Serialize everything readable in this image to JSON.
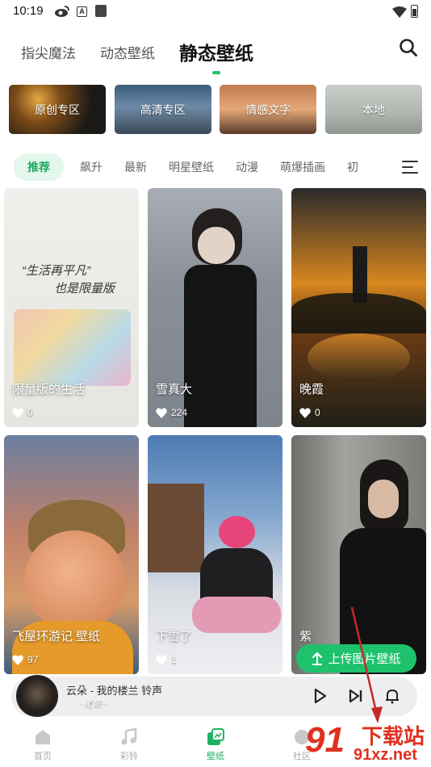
{
  "status_bar": {
    "time": "10:19",
    "a_icon": "A"
  },
  "top_tabs": [
    {
      "label": "指尖魔法",
      "active": false
    },
    {
      "label": "动态壁纸",
      "active": false
    },
    {
      "label": "静态壁纸",
      "active": true
    }
  ],
  "categories": [
    {
      "label": "原创专区"
    },
    {
      "label": "高清专区"
    },
    {
      "label": "情感文字"
    },
    {
      "label": "本地"
    }
  ],
  "sub_tabs": [
    {
      "label": "推荐",
      "active": true
    },
    {
      "label": "飙升"
    },
    {
      "label": "最新"
    },
    {
      "label": "明星壁纸"
    },
    {
      "label": "动漫"
    },
    {
      "label": "萌爆插画"
    },
    {
      "label": "初"
    }
  ],
  "wallpapers": [
    {
      "title": "限量版的生活",
      "likes": "0",
      "art": [
        "“生活再平凡”",
        "也是限量版"
      ]
    },
    {
      "title": "雪真大",
      "likes": "224"
    },
    {
      "title": "晚霞",
      "likes": "0"
    },
    {
      "title": "飞屋环游记 壁纸",
      "likes": "97"
    },
    {
      "title": "下雪了",
      "likes": "1"
    },
    {
      "title": "紫",
      "likes": ""
    }
  ],
  "upload_button": {
    "label": "上传图片壁纸"
  },
  "player": {
    "song": "云朵 - 我的楼兰 铃声",
    "lyric_hint": "~述说~"
  },
  "bottom_nav": [
    {
      "label": "首页",
      "icon": "home-icon"
    },
    {
      "label": "彩铃",
      "icon": "music-icon"
    },
    {
      "label": "壁纸",
      "icon": "wallpaper-icon",
      "active": true
    },
    {
      "label": "社区",
      "icon": "community-icon"
    }
  ],
  "watermark": {
    "text_top": "下载站",
    "text_bottom": "91xz.net",
    "digits": "91"
  },
  "colors": {
    "accent": "#1fc06a",
    "upload": "#1ec26c",
    "arrow": "#c62828"
  }
}
